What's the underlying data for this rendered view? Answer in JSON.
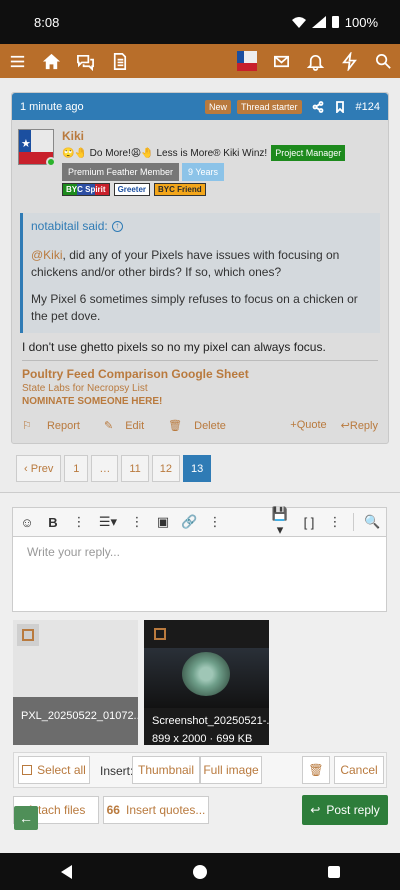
{
  "status": {
    "time": "8:08",
    "battery": "100%"
  },
  "post": {
    "time": "1 minute ago",
    "badge_new": "New",
    "badge_starter": "Thread starter",
    "number": "#124",
    "user": {
      "name": "Kiki",
      "title": "🙄🤚 Do More!😩🤚 Less is More® Kiki Winz!",
      "role": "Project Manager",
      "banner_premium": "Premium Feather Member",
      "banner_years": "9 Years",
      "small_banners": [
        "BYC Spirit",
        "Greeter",
        "BYC Friend"
      ]
    },
    "quote": {
      "author": "notabitail said:",
      "mention": "@Kiki",
      "line1": ", did any of your Pixels have issues with focusing on chickens and/or other birds? If so, which ones?",
      "line2": "My Pixel 6 sometimes simply refuses to focus on a chicken or the pet dove."
    },
    "body": "I don't use ghetto pixels so no my pixel can always focus.",
    "signature": {
      "line1": "Poultry Feed Comparison Google Sheet",
      "line2": "State Labs for Necropsy List",
      "line3": "NOMINATE SOMEONE HERE!"
    },
    "actions": {
      "report": "Report",
      "edit": "Edit",
      "delete": "Delete",
      "quote": "Quote",
      "reply": "Reply"
    }
  },
  "pagination": {
    "prev": "Prev",
    "pages": [
      "1",
      "…",
      "11",
      "12",
      "13"
    ],
    "current": "13"
  },
  "editor": {
    "placeholder": "Write your reply..."
  },
  "attachments": [
    {
      "name": "PXL_20250522_01072...",
      "meta": ""
    },
    {
      "name": "Screenshot_20250521-...",
      "meta": "899 x 2000 · 699 KB"
    }
  ],
  "insert_bar": {
    "select_all": "Select all",
    "insert_label": "Insert:",
    "thumbnail": "Thumbnail",
    "full_image": "Full image",
    "cancel": "Cancel"
  },
  "buttons": {
    "attach_files": "Attach files",
    "insert_quotes": "Insert quotes...",
    "post_reply": "Post reply"
  },
  "colors": {
    "brand": "#b86e2a",
    "accent_blue": "#2f7bb5",
    "link": "#b97a3e",
    "post_reply": "#2d7d3a"
  }
}
